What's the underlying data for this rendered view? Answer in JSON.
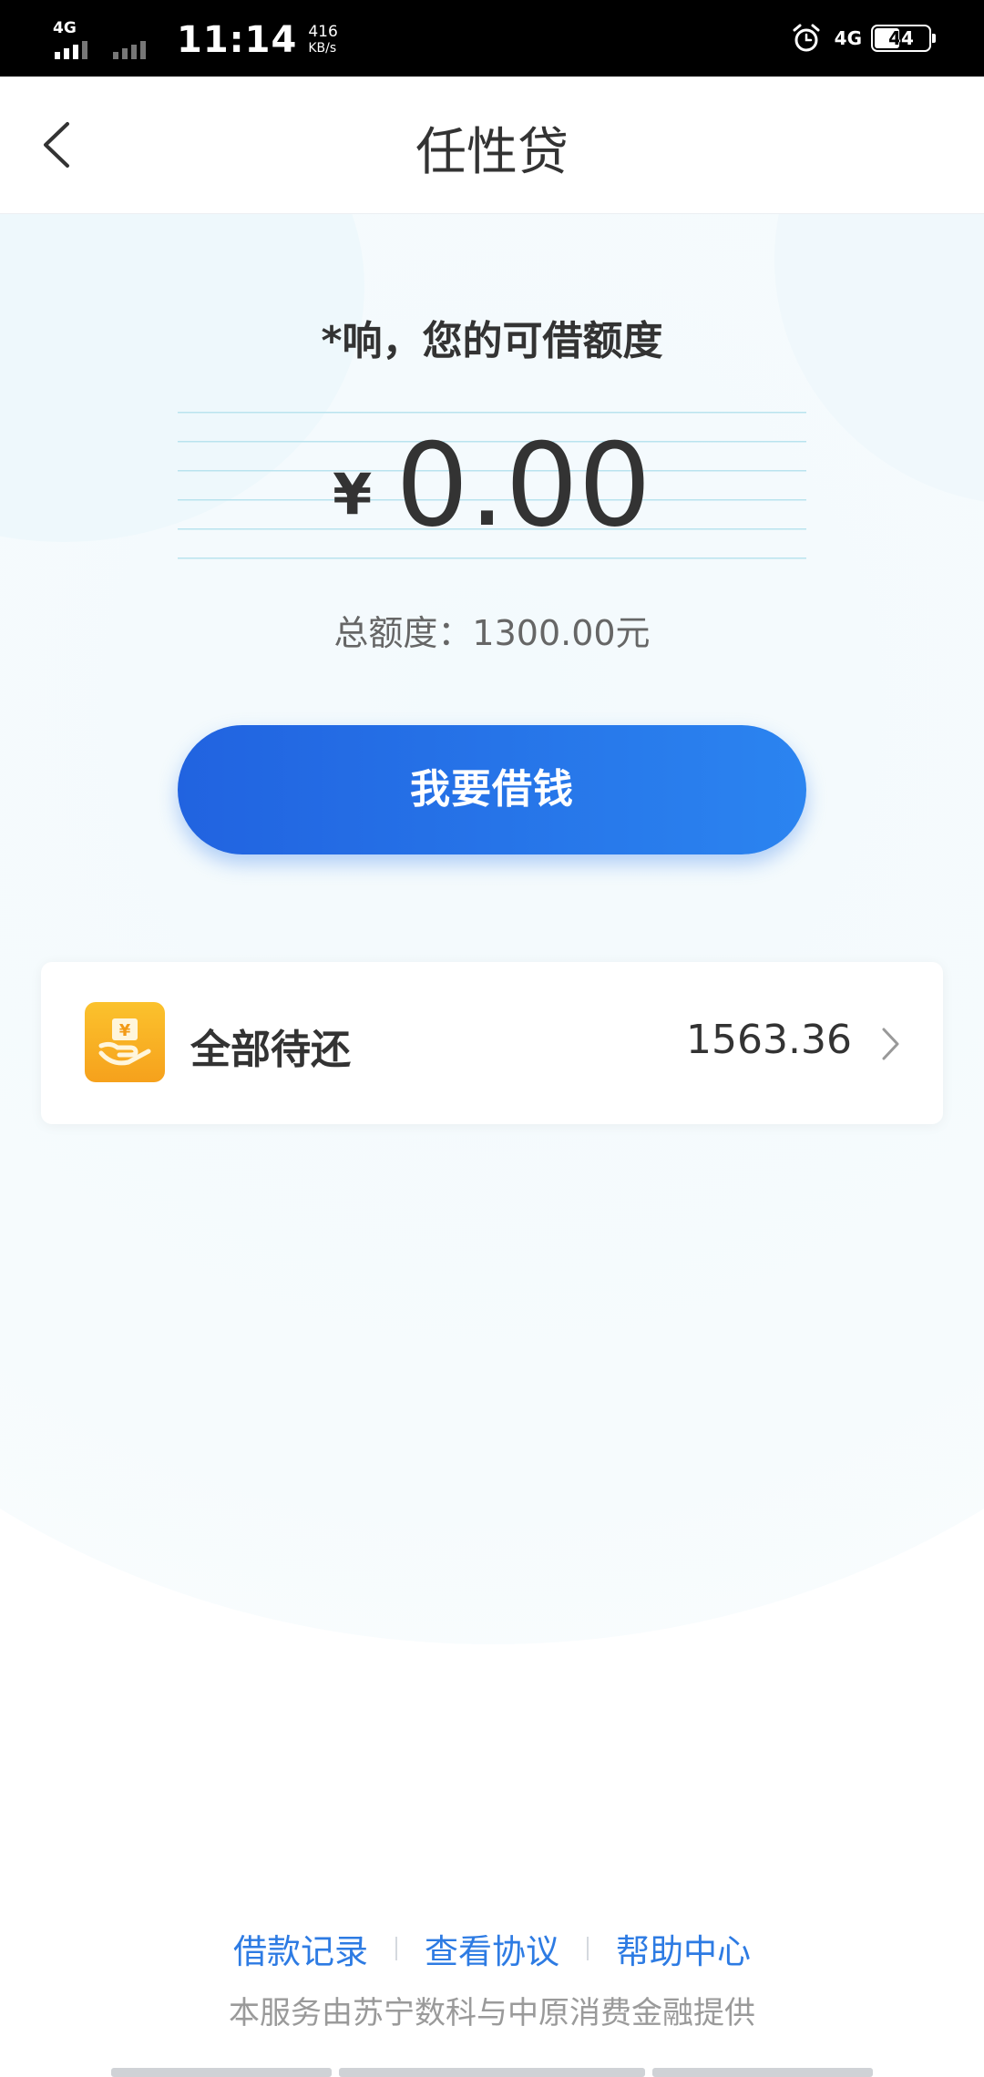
{
  "status_bar": {
    "network_tag_1": "4G",
    "time": "11:14",
    "speed_value": "416",
    "speed_unit": "KB/s",
    "network_right": "4G",
    "battery_level": "44"
  },
  "header": {
    "title": "任性贷"
  },
  "main": {
    "greeting": "*响，您的可借额度",
    "currency_symbol": "¥",
    "available_amount": "0.00",
    "total_limit": "总额度：1300.00元",
    "borrow_button_label": "我要借钱"
  },
  "repay": {
    "label": "全部待还",
    "amount": "1563.36"
  },
  "footer": {
    "links": [
      "借款记录",
      "查看协议",
      "帮助中心"
    ],
    "disclaimer": "本服务由苏宁数科与中原消费金融提供"
  },
  "colors": {
    "primary_blue": "#2b7de9",
    "repay_icon_orange": "#f8b022",
    "link_blue": "#2d7be3"
  }
}
